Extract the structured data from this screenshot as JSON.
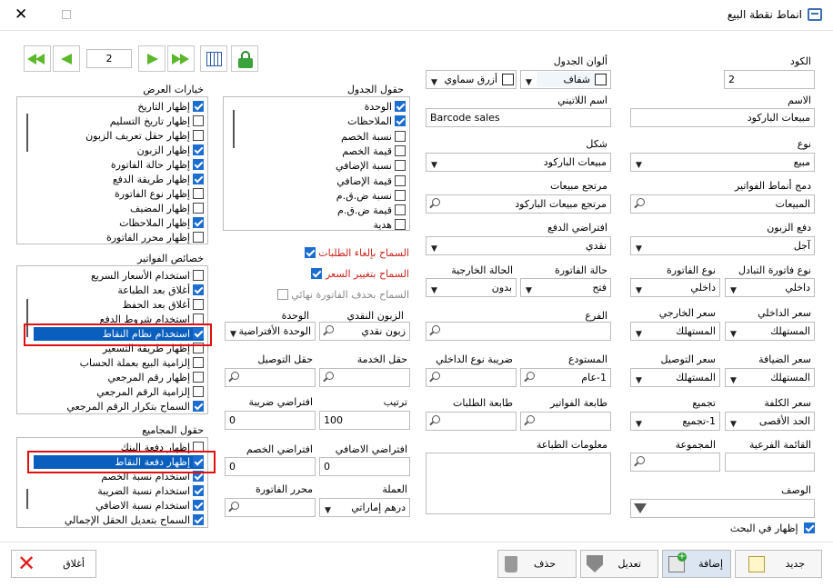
{
  "window": {
    "title": "انماط نقطة البيع",
    "close": "✕"
  },
  "nav": {
    "page": "2"
  },
  "fields": {
    "code_label": "الكود",
    "code": "2",
    "name_label": "الاسم",
    "name": "مبيعات الباركود",
    "type_label": "نوع",
    "type": "مبيع",
    "merge_label": "دمج أنماط الفواتير",
    "merge": "المبيعات",
    "cust_pay_label": "دفع الزبون",
    "cust_pay": "آجل",
    "trans_inv_type_label": "نوع فاتورة التبادل",
    "trans_inv_type": "داخلي",
    "inv_type_label": "نوع الفاتورة",
    "inv_type": "داخلي",
    "inv_status_label": "حالة الفاتورة",
    "inv_status": "فتح",
    "ext_status_label": "الحالة الخارجية",
    "ext_status": "بدون",
    "int_price_label": "سعر الداخلي",
    "int_price": "المستهلك",
    "ext_price_label": "سعر الخارجي",
    "ext_price": "المستهلك",
    "branch_label": "الفرع",
    "host_price_label": "سعر الضيافة",
    "host_price": "المستهلك",
    "delivery_price_label": "سعر التوصيل",
    "delivery_price": "المستهلك",
    "warehouse_label": "المستودع",
    "warehouse": "1-عام",
    "inner_tax_label": "ضريبة نوع الداخلي",
    "cost_price_label": "سعر الكلفة",
    "cost_price": "الحد الأقصى",
    "grouping_label": "تجميع",
    "grouping": "1-تجميع",
    "inv_printer_label": "طابعة الفواتير",
    "order_printer_label": "طابعة الطلبات",
    "sub_list_label": "القائمة الفرعية",
    "group_label": "المجموعة",
    "print_info_label": "معلومات الطباعة",
    "desc_label": "الوصف",
    "show_search_label": "إظهار في البحث",
    "table_colors_label": "ألوان الجدول",
    "table_color1": "شفاف",
    "table_color2": "أزرق سماوي",
    "latin_name_label": "اسم اللاتيني",
    "latin_name": "Barcode sales",
    "shape_label": "شكل",
    "shape": "مبيعات الباركود",
    "sales_return_label": "مرتجع مبيعات",
    "sales_return": "مرتجع مبيعات الباركود",
    "default_pay_label": "افتراضي الدفع",
    "default_pay": "نقدي",
    "cash_cust_label": "الزبون النقدي",
    "cash_cust": "زبون نقدي",
    "unit_label": "الوحدة",
    "unit": "الوحدة الأفتراضية",
    "service_field_label": "حقل الخدمة",
    "delivery_field_label": "حقل التوصيل",
    "order_label": "ترتيب",
    "order": "100",
    "default_tax_label": "افتراضي ضريبة",
    "default_tax": "0",
    "default_extra_label": "افتراضي الاضافي",
    "default_extra": "0",
    "default_disc_label": "افتراضي الخصم",
    "default_disc": "0",
    "currency_label": "العملة",
    "currency": "درهم إماراتي",
    "inv_editor_label": "محرر الفاتورة",
    "allow_cancel_label": "السماح بإلغاء الطلبات",
    "allow_price_label": "السماح بتغيير السعر",
    "allow_delete_label": "السماح بحذف الفاتورة نهائي"
  },
  "table_fields": {
    "title": "حقول الجدول",
    "items": [
      {
        "label": "الوحدة",
        "on": true
      },
      {
        "label": "الملاحظات",
        "on": true
      },
      {
        "label": "نسبة الخصم",
        "on": false
      },
      {
        "label": "قيمة الخصم",
        "on": false
      },
      {
        "label": "نسبة الإضافي",
        "on": false
      },
      {
        "label": "قيمة الإضافي",
        "on": false
      },
      {
        "label": "نسبة ض.ق.م",
        "on": false
      },
      {
        "label": "قيمة ض.ق.م",
        "on": false
      },
      {
        "label": "هدية",
        "on": false
      }
    ]
  },
  "display_options": {
    "title": "خيارات العرض",
    "items": [
      {
        "label": "إظهار التاريخ",
        "on": true
      },
      {
        "label": "إظهار تاريخ التسليم",
        "on": false
      },
      {
        "label": "إظهار حقل تعريف الزبون",
        "on": false
      },
      {
        "label": "إظهار الزبون",
        "on": true
      },
      {
        "label": "إظهار حالة الفاتورة",
        "on": true
      },
      {
        "label": "إظهار طريقة الدفع",
        "on": true
      },
      {
        "label": "إظهار نوع الفاتورة",
        "on": false
      },
      {
        "label": "إظهار المضيف",
        "on": false
      },
      {
        "label": "إظهار الملاحظات",
        "on": true
      },
      {
        "label": "إظهار محرر الفاتورة",
        "on": false
      }
    ]
  },
  "invoice_props": {
    "title": "خصائص الفواتير",
    "items": [
      {
        "label": "استخدام الأسعار السريع",
        "on": false
      },
      {
        "label": "أغلاق بعد الطباعة",
        "on": true
      },
      {
        "label": "أغلاق بعد الحفظ",
        "on": false
      },
      {
        "label": "استخدام شروط الدفع",
        "on": false
      },
      {
        "label": "استخدام نظام النقاط",
        "on": true
      },
      {
        "label": "إظهار طريقة التسعير",
        "on": false
      },
      {
        "label": "إلزامية البيع بعملة الحساب",
        "on": false
      },
      {
        "label": "إظهار رقم المرجعي",
        "on": false
      },
      {
        "label": "إلزامية الرقم المرجعي",
        "on": false
      },
      {
        "label": "السماح بتكرار الرقم المرجعي",
        "on": true
      }
    ]
  },
  "total_fields": {
    "title": "حقول المجاميع",
    "items": [
      {
        "label": "إظهار دفعة البنك",
        "on": false
      },
      {
        "label": "إظهار دفعة النقاط",
        "on": true
      },
      {
        "label": "استخدام نسبة الخصم",
        "on": true
      },
      {
        "label": "استخدام نسبة الضريبة",
        "on": true
      },
      {
        "label": "استخدام نسبة الاضافي",
        "on": true
      },
      {
        "label": "السماح بتعديل الحقل الإجمالي",
        "on": true
      }
    ]
  },
  "buttons": {
    "new": "جديد",
    "add": "إضافة",
    "edit": "تعديل",
    "delete": "حذف",
    "close": "أغلاق"
  }
}
